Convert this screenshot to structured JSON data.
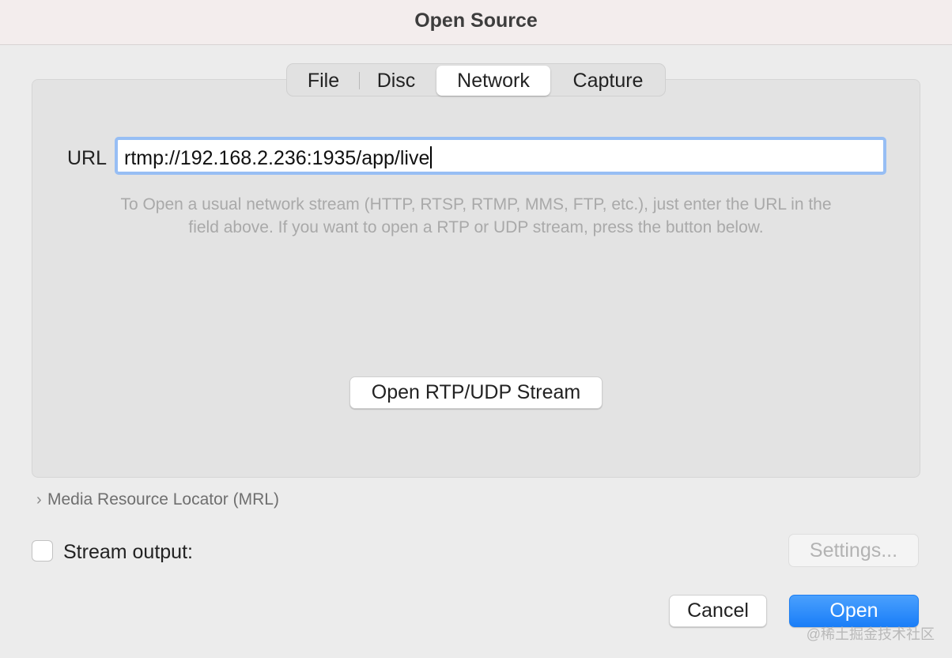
{
  "window": {
    "title": "Open Source"
  },
  "tabs": [
    {
      "label": "File",
      "active": false
    },
    {
      "label": "Disc",
      "active": false
    },
    {
      "label": "Network",
      "active": true
    },
    {
      "label": "Capture",
      "active": false
    }
  ],
  "network": {
    "url_label": "URL",
    "url_value": "rtmp://192.168.2.236:1935/app/live",
    "help_line1": "To Open a usual network stream (HTTP, RTSP, RTMP, MMS, FTP, etc.), just enter the URL in the",
    "help_line2": "field above. If you want to open a RTP or UDP stream, press the button below.",
    "rtp_button": "Open RTP/UDP Stream"
  },
  "mrl": {
    "label": "Media Resource Locator (MRL)",
    "icon": "chevron-right-icon"
  },
  "stream_output": {
    "label": "Stream output:",
    "checked": false,
    "settings_button": "Settings..."
  },
  "footer": {
    "cancel": "Cancel",
    "open": "Open"
  },
  "watermark": "@稀土掘金技术社区",
  "colors": {
    "accent": "#1a7ef8",
    "focus_ring": "#97bef4"
  }
}
